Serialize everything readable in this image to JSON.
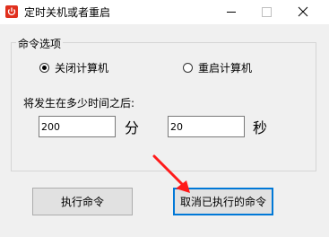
{
  "window": {
    "title": "定时关机或者重启"
  },
  "options_group": {
    "legend": "命令选项",
    "radio_shutdown": {
      "label": "关闭计算机",
      "checked": true
    },
    "radio_restart": {
      "label": "重启计算机",
      "checked": false
    },
    "prompt": "将发生在多少时间之后:",
    "minutes": {
      "value": "200",
      "unit": "分"
    },
    "seconds": {
      "value": "20",
      "unit": "秒"
    }
  },
  "buttons": {
    "execute": "执行命令",
    "cancel": "取消已执行的命令"
  },
  "colors": {
    "icon_red": "#e0301e",
    "arrow_red": "#ff1a1a",
    "focus_blue": "#0078d7"
  }
}
